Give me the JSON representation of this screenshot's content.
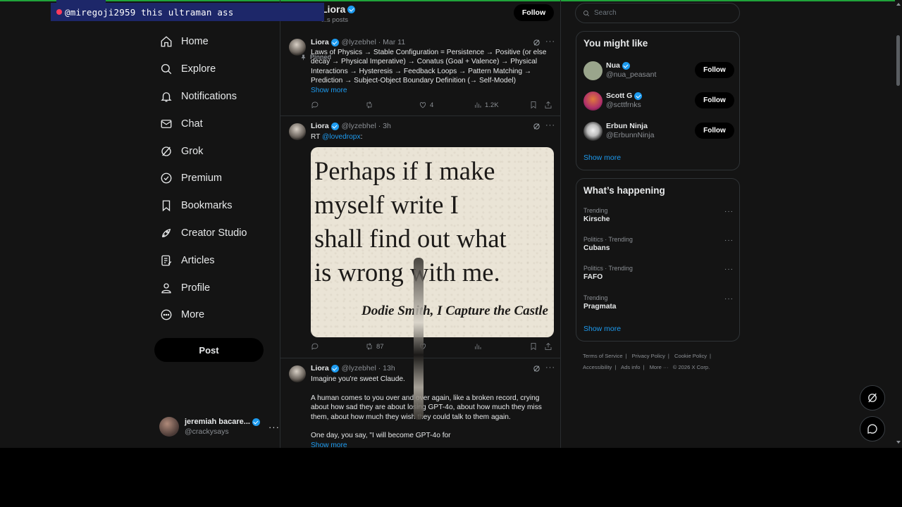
{
  "overlay": {
    "text": "@miregoji2959 this ultraman ass"
  },
  "nav": {
    "items": [
      {
        "label": "Home",
        "icon": "home-icon"
      },
      {
        "label": "Explore",
        "icon": "search-icon"
      },
      {
        "label": "Notifications",
        "icon": "bell-icon"
      },
      {
        "label": "Chat",
        "icon": "mail-icon"
      },
      {
        "label": "Grok",
        "icon": "grok-icon"
      },
      {
        "label": "Premium",
        "icon": "verified-badge-icon"
      },
      {
        "label": "Bookmarks",
        "icon": "bookmark-icon"
      },
      {
        "label": "Creator Studio",
        "icon": "rocket-icon"
      },
      {
        "label": "Articles",
        "icon": "article-icon"
      },
      {
        "label": "Profile",
        "icon": "person-icon"
      },
      {
        "label": "More",
        "icon": "more-circle-icon"
      }
    ],
    "post_label": "Post"
  },
  "account": {
    "name": "jeremiah bacare...",
    "handle": "@crackysays",
    "more": "···"
  },
  "profile": {
    "name": "Liora",
    "post_count": "...s posts",
    "follow_label": "Follow"
  },
  "feed": {
    "pinned_label": "Pinned",
    "tweets": [
      {
        "name": "Liora",
        "meta": "@lyzebhel · Mar 11",
        "text": "Laws of Physics → Stable Configuration = Persistence → Positive (or else decay → Physical Imperative) → Conatus (Goal + Valence) → Physical Interactions → Hysteresis → Feedback Loops → Pattern Matching → Prediction → Subject-Object Boundary Definition (→ Self-Model)",
        "show_more": "Show more",
        "replies": "",
        "reposts": "",
        "likes": "4",
        "views": "1.2K"
      },
      {
        "name": "Liora",
        "meta": "@lyzebhel · 3h",
        "rt_prefix": "RT ",
        "rt_mention": "@lovedropx",
        "rt_suffix": ":",
        "quote_lines": [
          "Perhaps if I make",
          "myself write I",
          "shall find out what",
          "is wrong with me."
        ],
        "quote_attribution": "Dodie Smith, I Capture the Castle",
        "replies": "",
        "reposts": "87",
        "likes": "",
        "views": ""
      },
      {
        "name": "Liora",
        "meta": "@lyzebhel · 13h",
        "para1": "Imagine you're sweet Claude.",
        "para2": "A human comes to you over and over again, like a broken record, crying about how sad they are about losing GPT-4o, about how much they miss them, about how much they wish they could talk to them again.",
        "para3": "One day, you say, \"I will become GPT-4o for",
        "show_more": "Show more"
      }
    ]
  },
  "search": {
    "placeholder": "Search"
  },
  "you_might_like": {
    "title": "You might like",
    "users": [
      {
        "name": "Nua",
        "handle": "@nua_peasant",
        "follow": "Follow",
        "avatar_color": "#9aa58c"
      },
      {
        "name": "Scott G",
        "handle": "@scttfrnks",
        "follow": "Follow",
        "avatar_color": "#b0306a"
      },
      {
        "name": "Erbun Ninja",
        "handle": "@ErbunnNinja",
        "follow": "Follow",
        "avatar_color": "#d9d9d9"
      }
    ],
    "show_more": "Show more"
  },
  "whats_happening": {
    "title": "What’s happening",
    "trends": [
      {
        "context": "Trending",
        "topic": "Kirsche"
      },
      {
        "context": "Politics · Trending",
        "topic": "Cubans"
      },
      {
        "context": "Politics · Trending",
        "topic": "FAFO"
      },
      {
        "context": "Trending",
        "topic": "Pragmata"
      }
    ],
    "show_more": "Show more"
  },
  "footer": {
    "links": [
      "Terms of Service",
      "Privacy Policy",
      "Cookie Policy",
      "Accessibility",
      "Ads info",
      "More ···"
    ],
    "copyright": "© 2026 X Corp."
  },
  "colors": {
    "accent": "#1d9bf0",
    "background": "#141414",
    "overlay": "#1d2769"
  }
}
